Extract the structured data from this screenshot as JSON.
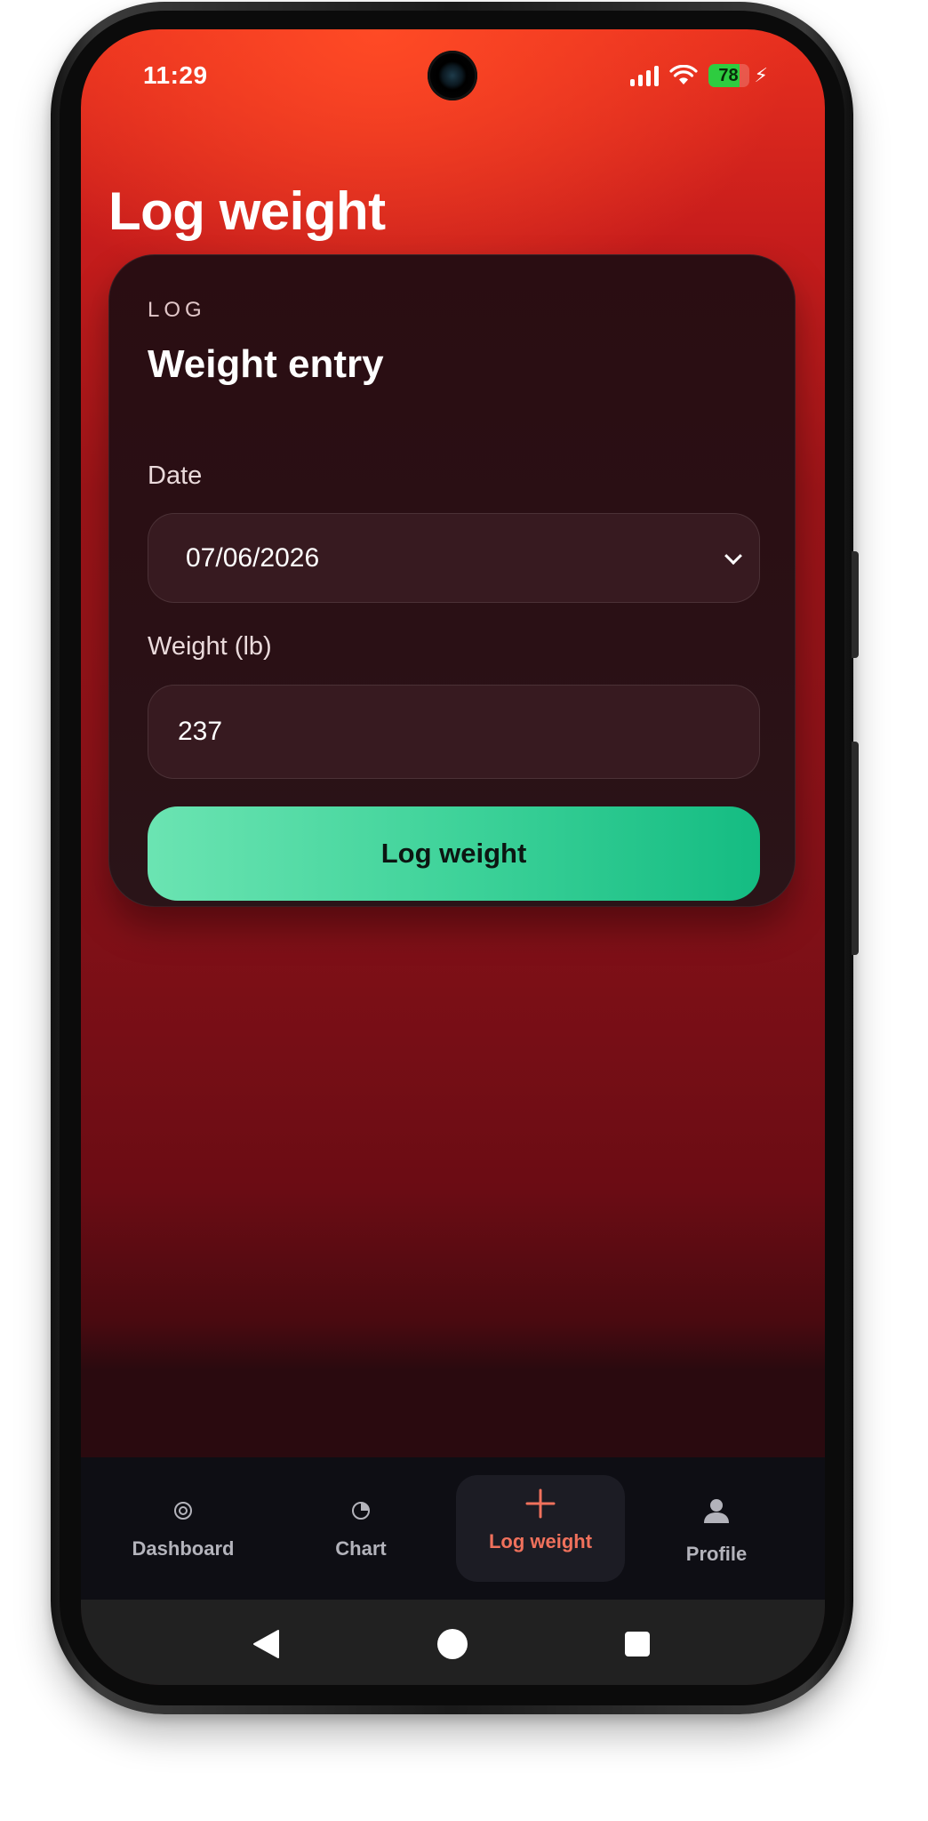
{
  "status_bar": {
    "time": "11:29",
    "battery_percent": "78",
    "battery_level": 0.78,
    "charging": true
  },
  "page": {
    "title": "Log weight"
  },
  "card": {
    "eyebrow": "LOG",
    "title": "Weight entry",
    "date_label": "Date",
    "date_value": "07/06/2026",
    "weight_label": "Weight (lb)",
    "weight_value": "237",
    "submit_label": "Log weight"
  },
  "bottom_nav": {
    "active": "log_weight",
    "items": [
      {
        "id": "dashboard",
        "label": "Dashboard",
        "icon": "target-icon"
      },
      {
        "id": "chart",
        "label": "Chart",
        "icon": "pie-chart-icon"
      },
      {
        "id": "log_weight",
        "label": "Log weight",
        "icon": "plus-icon"
      },
      {
        "id": "profile",
        "label": "Profile",
        "icon": "person-icon"
      }
    ]
  },
  "colors": {
    "accent_green": "#3fd39a",
    "active_nav": "#f0715c",
    "background_top": "#e8301f",
    "card_bg": "#2a0d12"
  }
}
